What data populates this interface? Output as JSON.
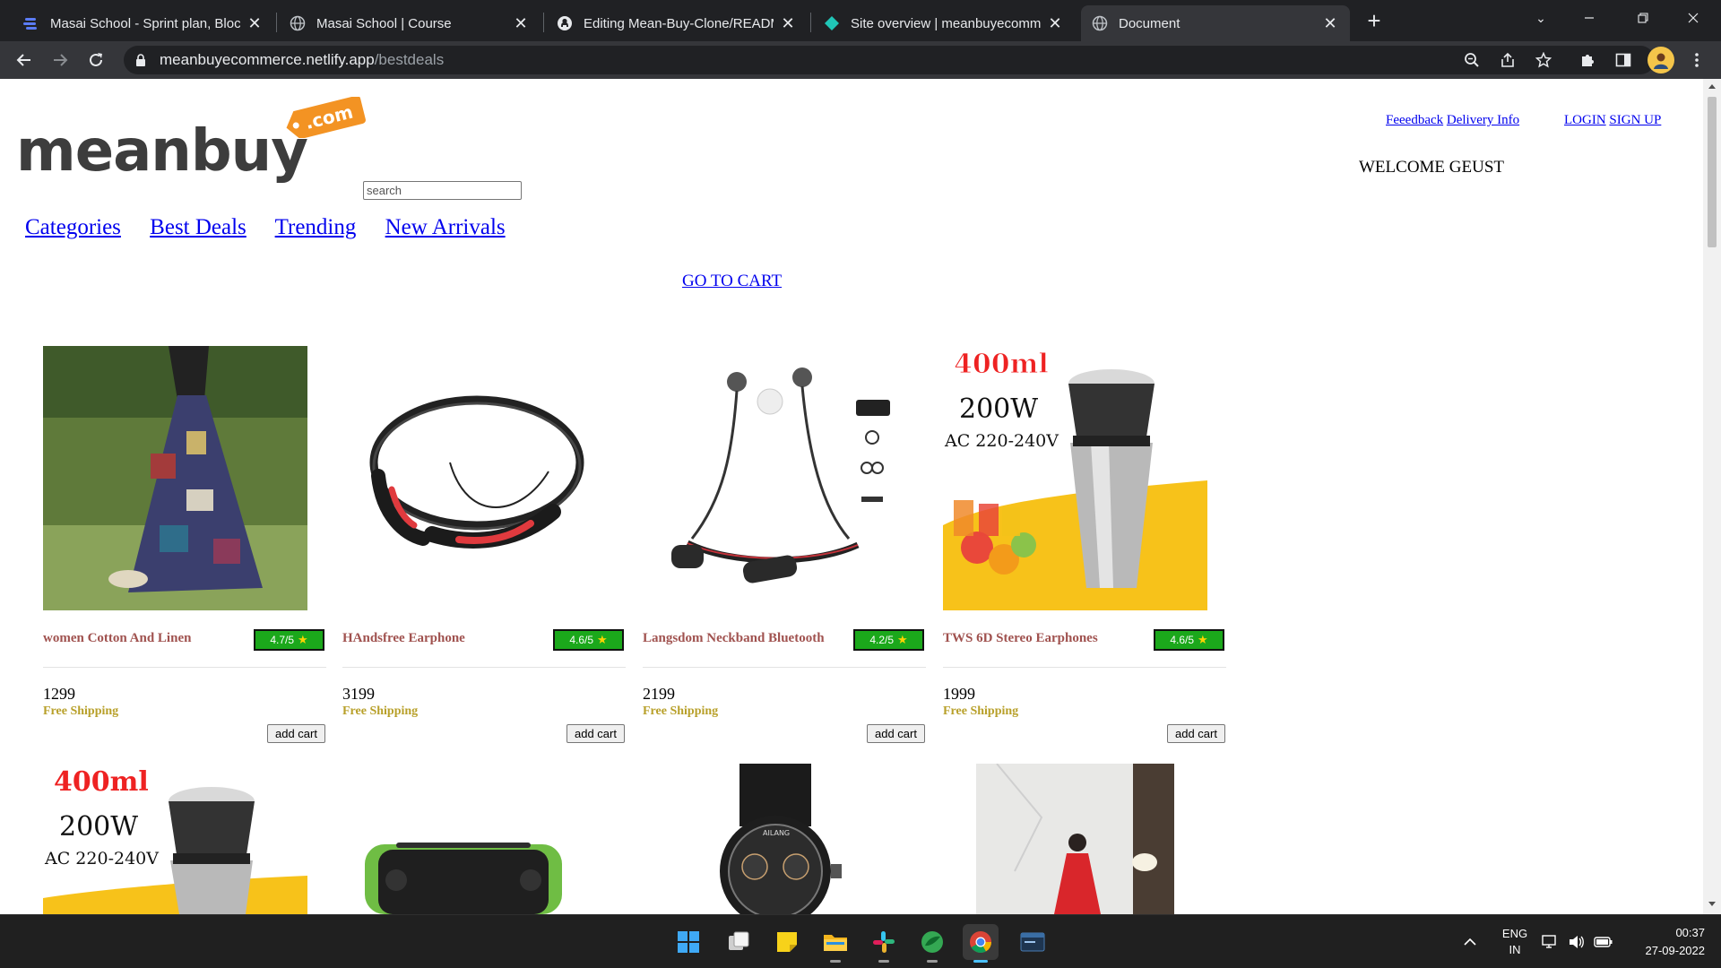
{
  "browser": {
    "tabs": [
      {
        "title": "Masai School - Sprint plan, Block",
        "icon": "masai-favicon",
        "active": false
      },
      {
        "title": "Masai School | Course",
        "icon": "globe-favicon",
        "active": false
      },
      {
        "title": "Editing Mean-Buy-Clone/READM",
        "icon": "github-favicon",
        "active": false
      },
      {
        "title": "Site overview | meanbuyecomme",
        "icon": "netlify-favicon",
        "active": false
      },
      {
        "title": "Document",
        "icon": "globe-favicon",
        "active": true
      }
    ],
    "url_host": "meanbuyecommerce.netlify.app",
    "url_path": "/bestdeals"
  },
  "site": {
    "logo_text": "meanbuy",
    "logo_tag": ".com",
    "search_placeholder": "search",
    "top_links": {
      "feedback": "Feeedback",
      "delivery": "Delivery Info",
      "login": "LOGIN",
      "signup": "SIGN UP"
    },
    "welcome": "WELCOME GEUST",
    "nav": {
      "categories": "Categories",
      "best_deals": "Best Deals",
      "trending": "Trending",
      "new_arrivals": "New Arrivals"
    },
    "go_to_cart": "GO TO CART"
  },
  "products": [
    {
      "name": "women Cotton And Linen",
      "rating": "4.7/5",
      "price": "1299",
      "shipping": "Free Shipping",
      "button": "add cart"
    },
    {
      "name": "HAndsfree Earphone",
      "rating": "4.6/5",
      "price": "3199",
      "shipping": "Free Shipping",
      "button": "add cart"
    },
    {
      "name": "Langsdom Neckband Bluetooth",
      "rating": "4.2/5",
      "price": "2199",
      "shipping": "Free Shipping",
      "button": "add cart"
    },
    {
      "name": "TWS 6D Stereo Earphones",
      "rating": "4.6/5",
      "price": "1999",
      "shipping": "Free Shipping",
      "button": "add cart"
    }
  ],
  "product_images": {
    "juicer_capacity": "400ml",
    "juicer_power": "200W",
    "juicer_voltage": "AC 220-240V",
    "watch_brand": "AILANG"
  },
  "taskbar": {
    "apps": [
      "windows-start",
      "task-view",
      "sticky-notes",
      "file-explorer",
      "slack",
      "cucumber-app",
      "chrome",
      "mysql-workbench"
    ],
    "language_line1": "ENG",
    "language_line2": "IN",
    "time": "00:37",
    "date": "27-09-2022"
  },
  "colors": {
    "rating_badge": "#1ba81b",
    "product_name": "#a0524f",
    "free_shipping": "#b8a02a",
    "logo_orange": "#f39323",
    "link": "#0000ee"
  }
}
